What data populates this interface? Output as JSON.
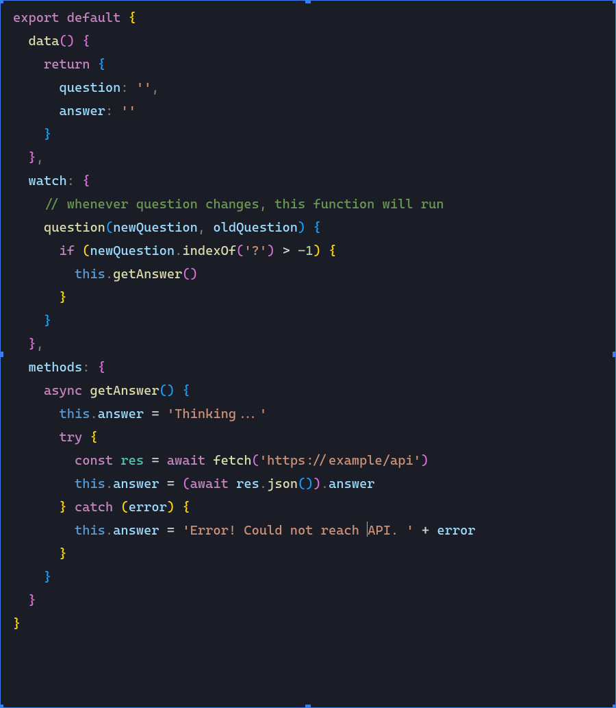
{
  "code": {
    "kw_export": "export",
    "kw_default": "default",
    "fn_data": "data",
    "kw_return": "return",
    "prop_question": "question",
    "prop_answer": "answer",
    "empty_str": "''",
    "prop_watch": "watch",
    "comment_watch": "// whenever question changes, this function will run",
    "fn_question": "question",
    "param_newQ": "newQuestion",
    "param_oldQ": "oldQuestion",
    "kw_if": "if",
    "method_indexOf": "indexOf",
    "str_qmark": "'?'",
    "num_neg1": "-1",
    "kw_this": "this",
    "method_getAnswer": "getAnswer",
    "prop_methods": "methods",
    "kw_async": "async",
    "str_thinking": "'Thinking...'",
    "kw_try": "try",
    "kw_const": "const",
    "id_res": "res",
    "kw_await": "await",
    "fn_fetch": "fetch",
    "str_url": "'https://example/api'",
    "method_json": "json",
    "kw_catch": "catch",
    "id_error": "error",
    "str_err_a": "'Error! Could not reach ",
    "str_err_b": "API. '",
    "op_gt": ">",
    "op_eq": "=",
    "op_plus": "+"
  }
}
